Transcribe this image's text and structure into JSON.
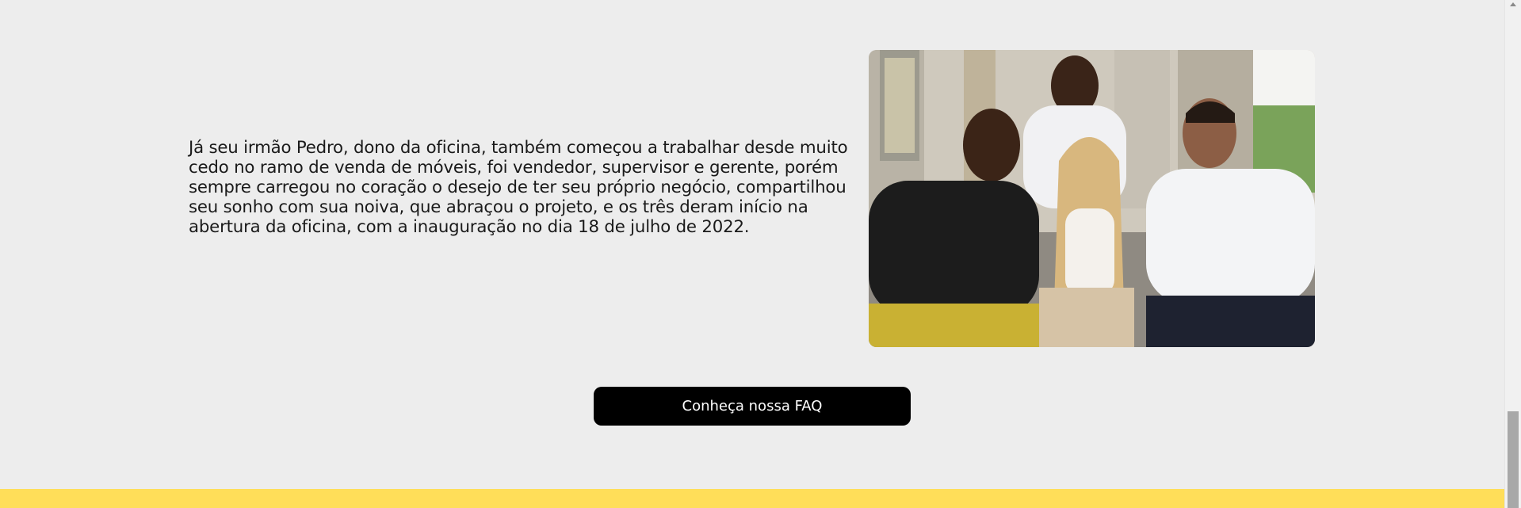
{
  "about": {
    "paragraph": "Já seu irmão Pedro, dono da oficina, também começou a trabalhar desde muito cedo no ramo de venda de móveis, foi vendedor, supervisor e gerente, porém sempre carregou no coração o desejo de ter seu próprio negócio, compartilhou seu sonho com sua noiva, que abraçou o projeto, e os três deram início na abertura da oficina, com a inauguração no dia 18 de julho de 2022."
  },
  "cta": {
    "faq_label": "Conheça nossa FAQ"
  },
  "colors": {
    "background": "#ededed",
    "button": "#000000",
    "button_text": "#ffffff",
    "footer_band": "#ffde59"
  }
}
